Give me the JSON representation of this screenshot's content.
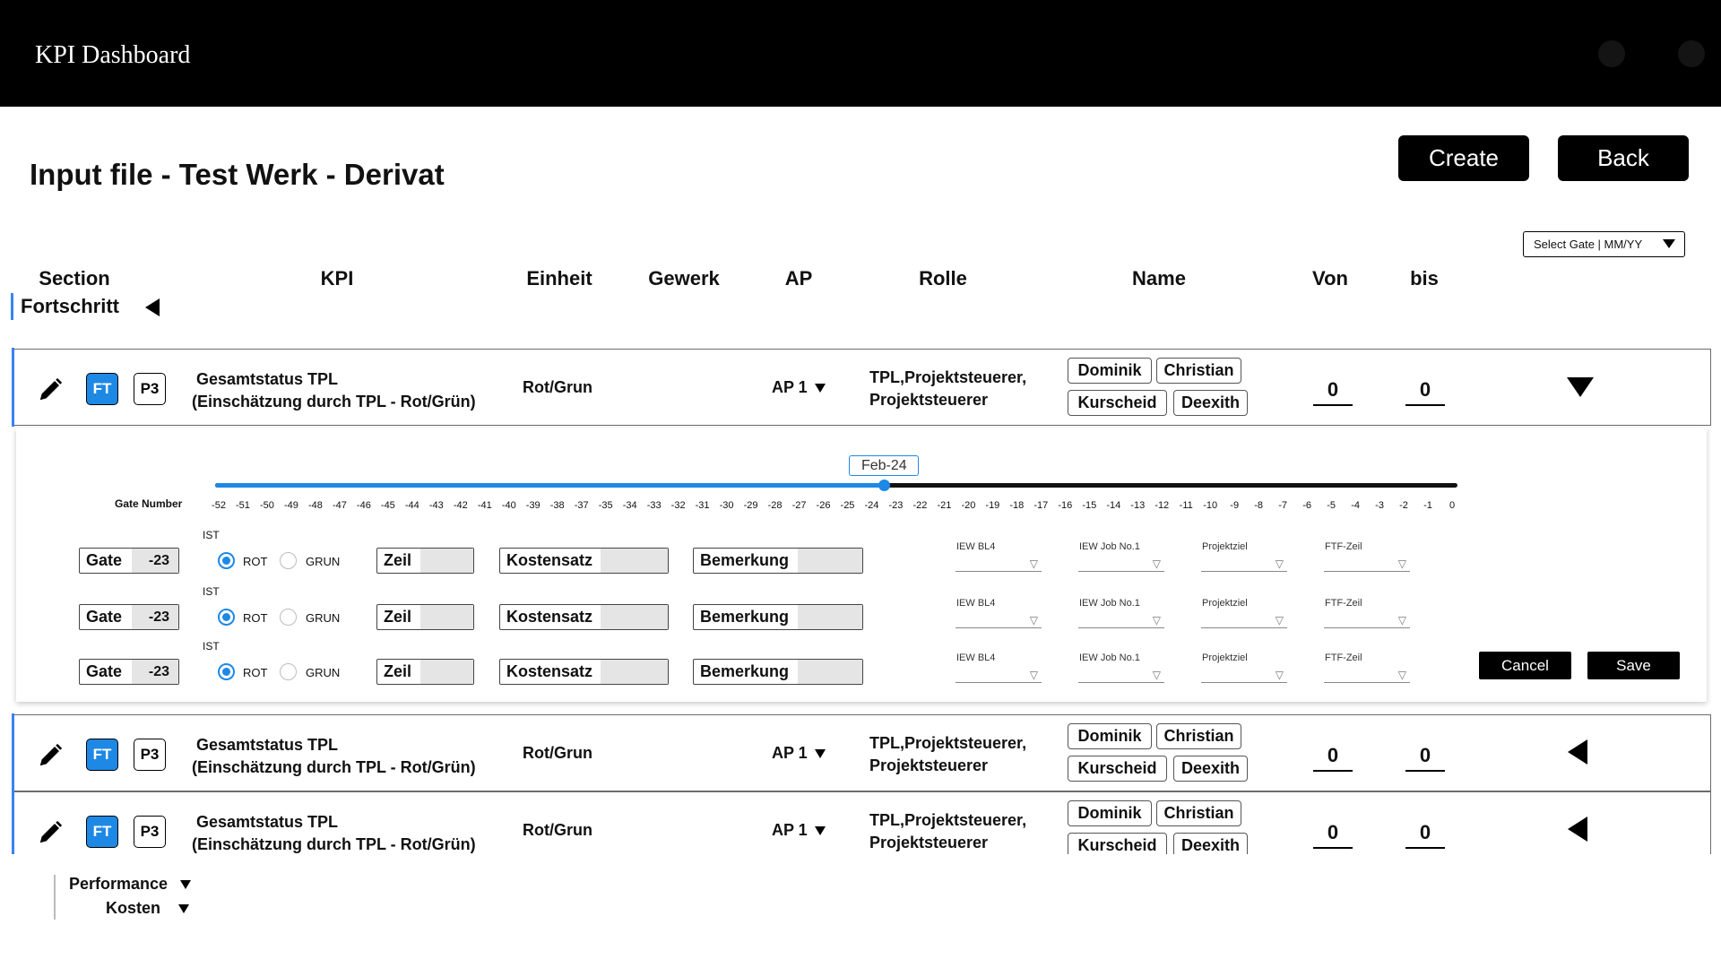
{
  "app": {
    "title": "KPI Dashboard"
  },
  "page": {
    "title": "Input file - Test Werk - Derivat",
    "create_label": "Create",
    "back_label": "Back",
    "gate_select": "Select Gate | MM/YY"
  },
  "columns": [
    "Section",
    "KPI",
    "Einheit",
    "Gewerk",
    "AP",
    "Rolle",
    "Name",
    "Von",
    "bis"
  ],
  "section": {
    "label": "Fortschritt"
  },
  "rows": [
    {
      "ft": "FT",
      "p3": "P3",
      "kpi_l1": "Gesamtstatus TPL",
      "kpi_l2": "(Einschätzung durch TPL - Rot/Grün)",
      "einheit": "Rot/Grun",
      "ap": "AP 1",
      "rolle_l1": "TPL,Projektsteuerer,",
      "rolle_l2": "Projektsteuerer",
      "names": [
        "Dominik",
        "Christian",
        "Kurscheid",
        "Deexith"
      ],
      "von": "0",
      "bis": "0",
      "expanded": true
    },
    {
      "ft": "FT",
      "p3": "P3",
      "kpi_l1": "Gesamtstatus TPL",
      "kpi_l2": "(Einschätzung durch TPL - Rot/Grün)",
      "einheit": "Rot/Grun",
      "ap": "AP 1",
      "rolle_l1": "TPL,Projektsteuerer,",
      "rolle_l2": "Projektsteuerer",
      "names": [
        "Dominik",
        "Christian",
        "Kurscheid",
        "Deexith"
      ],
      "von": "0",
      "bis": "0",
      "expanded": false
    },
    {
      "ft": "FT",
      "p3": "P3",
      "kpi_l1": "Gesamtstatus TPL",
      "kpi_l2": "(Einschätzung durch TPL - Rot/Grün)",
      "einheit": "Rot/Grun",
      "ap": "AP 1",
      "rolle_l1": "TPL,Projektsteuerer,",
      "rolle_l2": "Projektsteuerer",
      "names": [
        "Dominik",
        "Christian",
        "Kurscheid",
        "Deexith"
      ],
      "von": "0",
      "bis": "0",
      "expanded": false
    }
  ],
  "detail": {
    "gate_number_label": "Gate Number",
    "slider_value_label": "Feb-24",
    "slider_value": -24,
    "slider_min": -52,
    "slider_max": 0,
    "ticks": [
      "-52",
      "-51",
      "-50",
      "-49",
      "-48",
      "-47",
      "-46",
      "-45",
      "-44",
      "-43",
      "-42",
      "-41",
      "-40",
      "-39",
      "-38",
      "-37",
      "-35",
      "-34",
      "-33",
      "-32",
      "-31",
      "-30",
      "-29",
      "-28",
      "-27",
      "-26",
      "-25",
      "-24",
      "-23",
      "-22",
      "-21",
      "-20",
      "-19",
      "-18",
      "-17",
      "-16",
      "-15",
      "-14",
      "-13",
      "-12",
      "-11",
      "-10",
      "-9",
      "-8",
      "-7",
      "-6",
      "-5",
      "-4",
      "-3",
      "-2",
      "-1",
      "0"
    ],
    "field_rows": [
      {
        "gate_label": "Gate",
        "gate_value": "-23",
        "ist": "IST",
        "rot": "ROT",
        "grun": "GRUN",
        "selected": "ROT",
        "zeil": "Zeil",
        "kostensatz": "Kostensatz",
        "bemerkung": "Bemerkung",
        "iew_bl4": "IEW BL4",
        "iew_job": "IEW Job No.1",
        "projektziel": "Projektziel",
        "ftf_zeil": "FTF-Zeil"
      },
      {
        "gate_label": "Gate",
        "gate_value": "-23",
        "ist": "IST",
        "rot": "ROT",
        "grun": "GRUN",
        "selected": "ROT",
        "zeil": "Zeil",
        "kostensatz": "Kostensatz",
        "bemerkung": "Bemerkung",
        "iew_bl4": "IEW BL4",
        "iew_job": "IEW Job No.1",
        "projektziel": "Projektziel",
        "ftf_zeil": "FTF-Zeil"
      },
      {
        "gate_label": "Gate",
        "gate_value": "-23",
        "ist": "IST",
        "rot": "ROT",
        "grun": "GRUN",
        "selected": "ROT",
        "zeil": "Zeil",
        "kostensatz": "Kostensatz",
        "bemerkung": "Bemerkung",
        "iew_bl4": "IEW BL4",
        "iew_job": "IEW Job No.1",
        "projektziel": "Projektziel",
        "ftf_zeil": "FTF-Zeil"
      }
    ],
    "cancel_label": "Cancel",
    "save_label": "Save"
  },
  "bottom_nav": [
    {
      "label": "Performance"
    },
    {
      "label": "Kosten"
    }
  ],
  "colors": {
    "accent": "#1e88e5",
    "header": "#000000"
  },
  "icons": {
    "edit": "pencil-icon",
    "expand": "triangle-down-icon",
    "collapse": "triangle-left-icon"
  }
}
